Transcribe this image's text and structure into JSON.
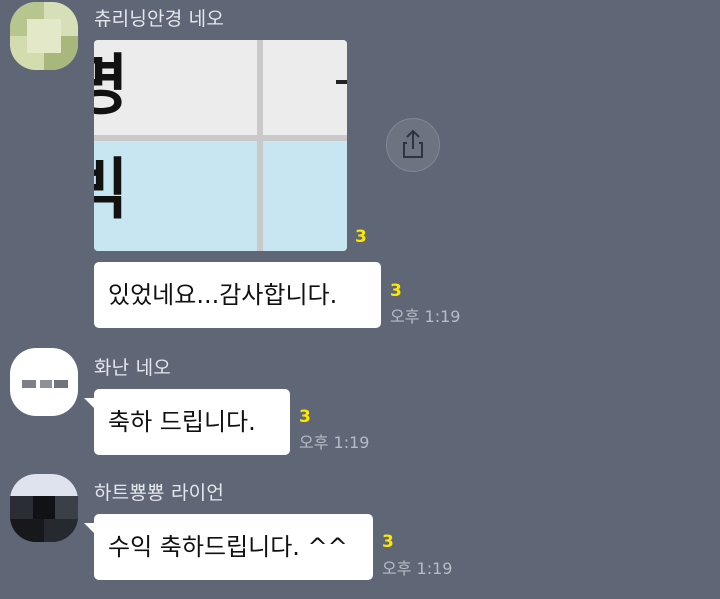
{
  "messages": [
    {
      "sender": "츄리닝안경 네오",
      "image_text_top": "명",
      "image_text_bottom": "빅",
      "image_unread": "3",
      "text": "있었네요...감사합니다.",
      "unread": "3",
      "time": "오후 1:19"
    },
    {
      "sender": "화난 네오",
      "text": "축하 드립니다.",
      "unread": "3",
      "time": "오후 1:19"
    },
    {
      "sender": "하트뿅뿅 라이언",
      "text": "수익 축하드립니다. ^^",
      "unread": "3",
      "time": "오후 1:19"
    }
  ],
  "icons": {
    "share": "share-icon"
  },
  "colors": {
    "background": "#5f6776",
    "bubble": "#ffffff",
    "unread": "#ffe600",
    "image_highlight": "#c7e6f2"
  }
}
